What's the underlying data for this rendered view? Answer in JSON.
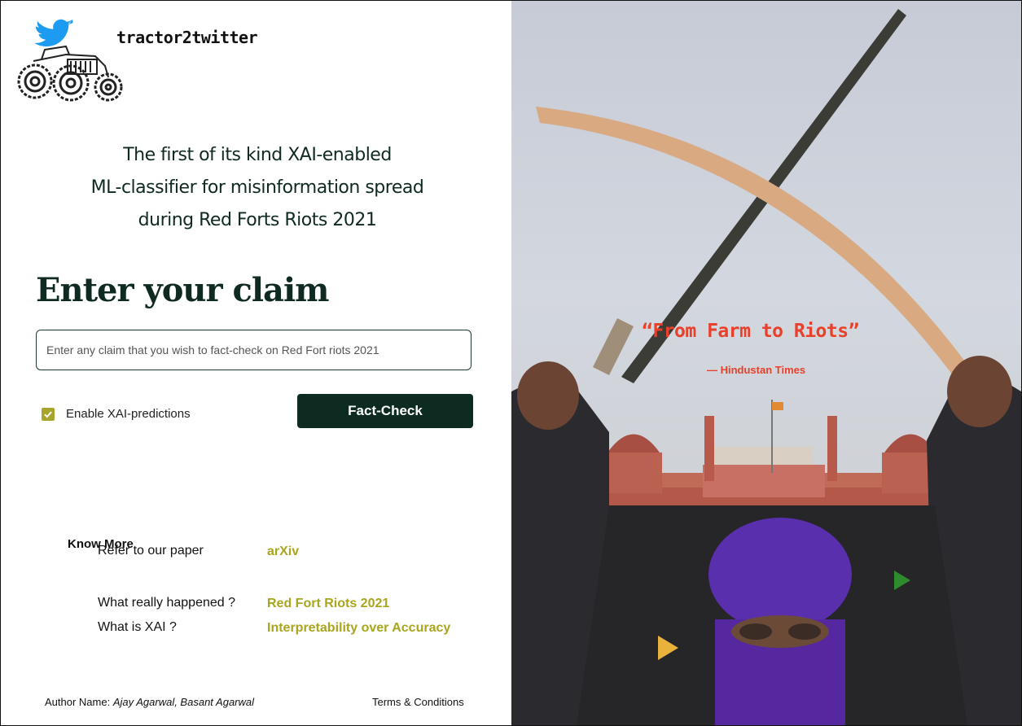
{
  "brand": {
    "name": "tractor2twitter"
  },
  "tagline": {
    "line1": "The first of its kind XAI-enabled",
    "line2": "ML-classifier for misinformation spread",
    "line3": "during Red Forts Riots 2021"
  },
  "claim": {
    "heading": "Enter your claim",
    "placeholder": "Enter any claim that you wish to fact-check on Red Fort riots 2021",
    "value": ""
  },
  "xai_toggle": {
    "label": "Enable XAI-predictions",
    "checked": true
  },
  "fact_check_button": {
    "label": "Fact-Check"
  },
  "know_more": {
    "title": "Know More",
    "items": [
      {
        "label": "Refer to our paper",
        "link": "arXiv"
      },
      {
        "label": "What really happened ?",
        "link": "Red Fort Riots 2021"
      },
      {
        "label": "What is XAI ?",
        "link": "Interpretability over Accuracy"
      }
    ]
  },
  "footer": {
    "author_prefix": "Author Name: ",
    "author_names": "Ajay Agarwal, Basant Agarwal",
    "terms": "Terms & Conditions"
  },
  "photo": {
    "quote": "“From Farm to Riots”",
    "quote_source": "— Hindustan Times"
  },
  "colors": {
    "brand_dark": "#0e2b22",
    "accent_olive": "#a9a51c",
    "quote_red": "#e8402a",
    "twitter_blue": "#1d9bf0"
  },
  "icons": {
    "logo": "twitter-bird-tractor-logo",
    "checkbox": "check-icon"
  }
}
